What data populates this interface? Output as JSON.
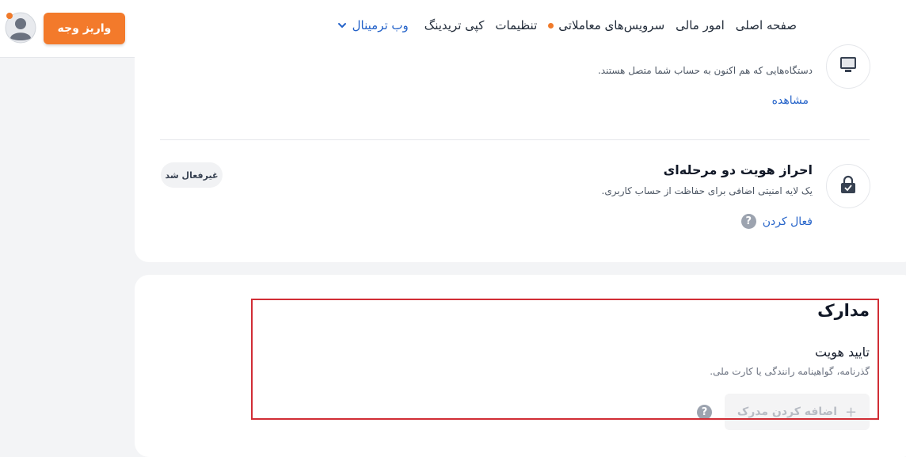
{
  "nav": {
    "home": "صفحه اصلی",
    "finance": "امور مالی",
    "trading_services": "سرویس‌های معاملاتی",
    "settings": "تنظیمات",
    "copy_trading": "کپی تریدینگ",
    "web_terminal": "وب ترمینال"
  },
  "header": {
    "deposit_label": "واریز وجه"
  },
  "devices": {
    "description": "دستگاه‌هایی که هم اکنون به حساب شما متصل هستند.",
    "view_link": "مشاهده"
  },
  "two_factor": {
    "title": "احراز هویت دو مرحله‌ای",
    "description": "یک لایه امنیتی اضافی برای حفاظت از حساب کاربری.",
    "activate_link": "فعال کردن",
    "status_badge": "غیرفعال شد",
    "help_glyph": "?"
  },
  "documents": {
    "title": "مدارک",
    "identity_title": "تایید هویت",
    "identity_description": "گذرنامه، گواهینامه رانندگی یا کارت ملی.",
    "add_button_label": "اضافه کردن مدرک",
    "add_button_icon": "+",
    "help_glyph": "?"
  },
  "colors": {
    "accent": "#f37a2b",
    "link": "#2563c9",
    "highlight_border": "#d12d35"
  }
}
